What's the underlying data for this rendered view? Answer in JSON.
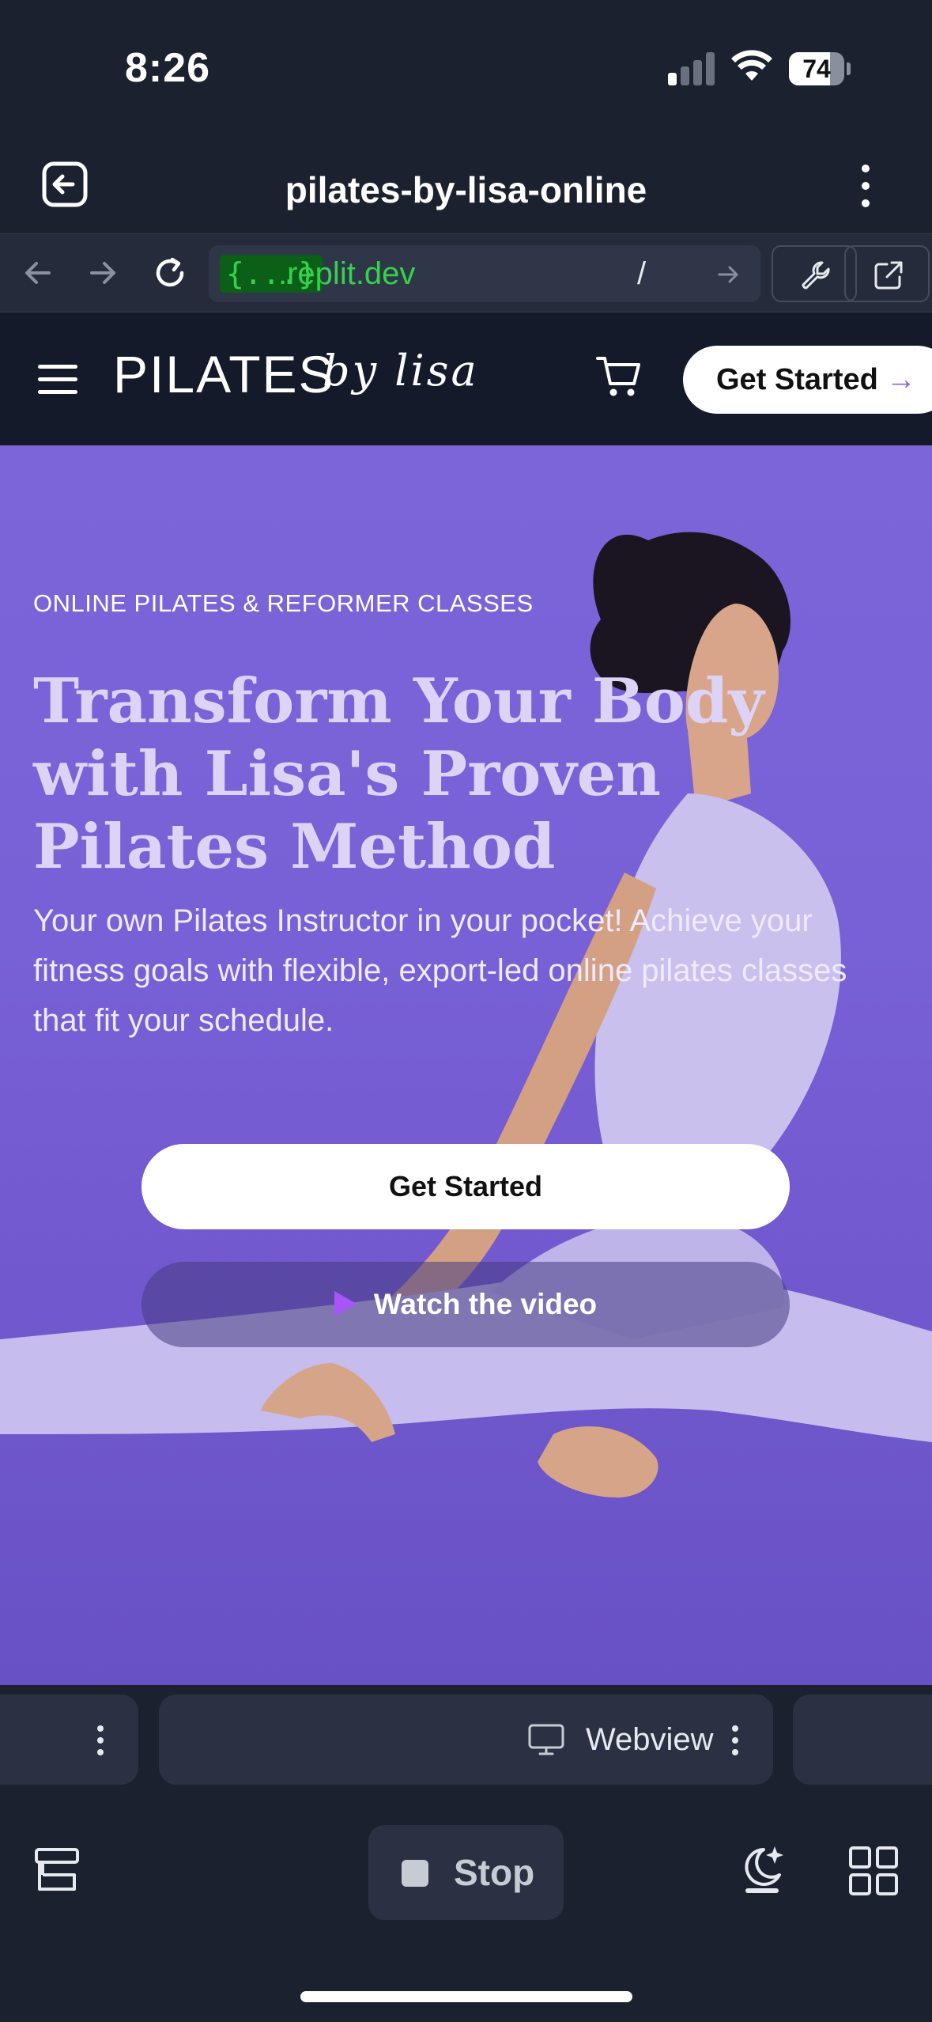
{
  "status_bar": {
    "time": "8:26",
    "battery": "74",
    "battery_fraction": 0.74
  },
  "app_header": {
    "title": "pilates-by-lisa-online"
  },
  "browser": {
    "url_badge": "{...}",
    "url_domain": ".replit.dev",
    "url_path": "/"
  },
  "site": {
    "logo_main": "PILATES",
    "logo_script": "by lisa",
    "nav_cta": "Get Started",
    "nav_cta_arrow": "→"
  },
  "hero": {
    "eyebrow": "ONLINE PILATES & REFORMER CLASSES",
    "headline": "Transform Your Body with Lisa's Proven Pilates Method",
    "subtext": "Your own Pilates Instructor in your pocket! Achieve your fitness goals with flexible, export-led online pilates classes that fit your schedule.",
    "primary_cta": "Get Started",
    "video_cta": "Watch the video"
  },
  "tab_strip": {
    "active_tab": "Webview"
  },
  "bottom_bar": {
    "stop_label": "Stop"
  },
  "colors": {
    "app_bg": "#1c2130",
    "hero_purple": "#7a61d8",
    "url_green": "#35d24f",
    "accent_violet": "#a855f7"
  }
}
